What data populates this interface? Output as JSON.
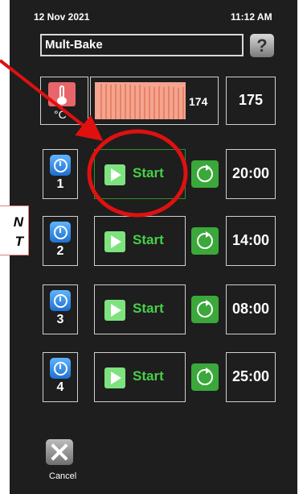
{
  "header": {
    "date": "12 Nov 2021",
    "time": "11:12 AM"
  },
  "program": {
    "name": "Mult-Bake",
    "help_icon": "question-icon",
    "help_symbol": "?"
  },
  "temperature": {
    "icon": "thermometer-icon",
    "unit": "°C",
    "current": "174",
    "setpoint": "175"
  },
  "timers": [
    {
      "number": "1",
      "start_label": "Start",
      "time": "20:00",
      "highlighted": true
    },
    {
      "number": "2",
      "start_label": "Start",
      "time": "14:00",
      "highlighted": false
    },
    {
      "number": "3",
      "start_label": "Start",
      "time": "08:00",
      "highlighted": false
    },
    {
      "number": "4",
      "start_label": "Start",
      "time": "25:00",
      "highlighted": false
    }
  ],
  "cancel": {
    "label": "Cancel",
    "icon": "close-icon"
  },
  "annotation": {
    "line1": "N",
    "line2": "T",
    "color": "#e01010"
  },
  "colors": {
    "accent_green": "#46d046",
    "timer_blue": "#2a88e8",
    "temp_red": "#e8666b"
  }
}
